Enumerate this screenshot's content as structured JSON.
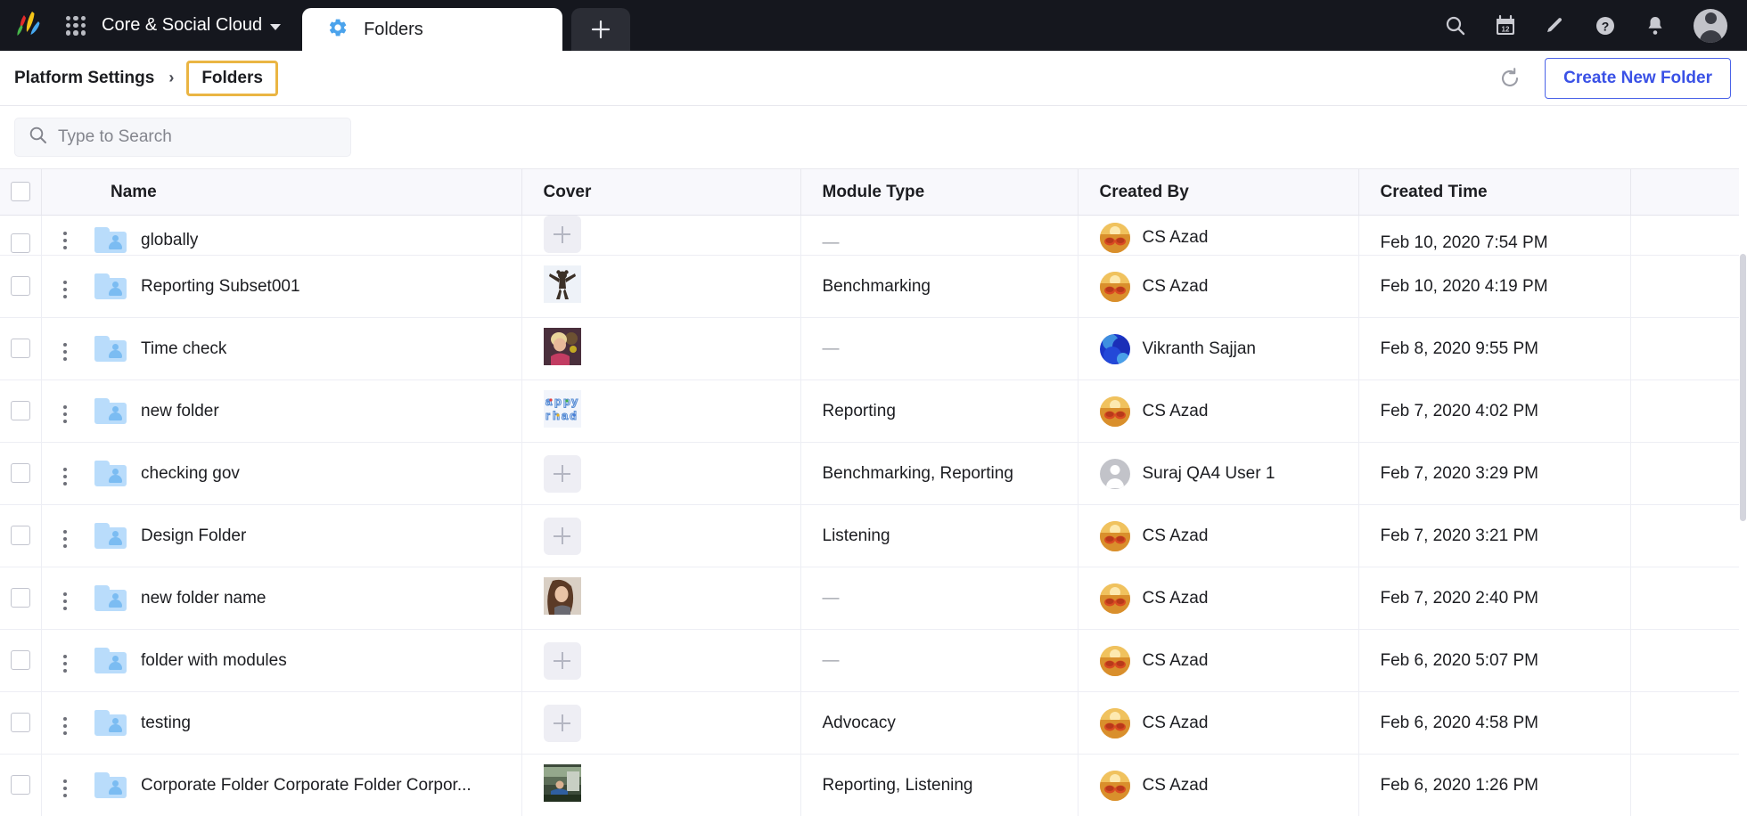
{
  "topbar": {
    "logo": "sprinklr-logo",
    "app_grid_label": "app-grid",
    "workspace": "Core & Social Cloud",
    "tabs": [
      {
        "label": "Folders",
        "icon": "gear-icon",
        "active": true
      }
    ],
    "new_tab_label": "+",
    "icons": [
      {
        "name": "search-icon"
      },
      {
        "name": "calendar-icon",
        "badge": "12"
      },
      {
        "name": "edit-pencil-icon"
      },
      {
        "name": "help-icon"
      },
      {
        "name": "notifications-bell-icon"
      }
    ],
    "avatar": "user-avatar"
  },
  "breadcrumb": {
    "parent": "Platform Settings",
    "separator": "›",
    "current": "Folders",
    "refresh_label": "refresh-icon",
    "create_button": "Create New Folder"
  },
  "search": {
    "placeholder": "Type to Search",
    "value": "",
    "icon": "search-icon"
  },
  "table": {
    "columns": [
      "Name",
      "Cover",
      "Module Type",
      "Created By",
      "Created Time"
    ],
    "rows": [
      {
        "name": "globally",
        "cover": "placeholder",
        "module_type": "—",
        "created_by": "CS Azad",
        "avatar": "sunset",
        "created_time": "Feb 10, 2020 7:54 PM",
        "clipped": true
      },
      {
        "name": "Reporting Subset001",
        "cover": "photo-bear",
        "module_type": "Benchmarking",
        "created_by": "CS Azad",
        "avatar": "sunset",
        "created_time": "Feb 10, 2020 4:19 PM"
      },
      {
        "name": "Time check",
        "cover": "photo-woman-blonde",
        "module_type": "—",
        "created_by": "Vikranth Sajjan",
        "avatar": "blue",
        "created_time": "Feb 8, 2020 9:55 PM"
      },
      {
        "name": "new folder",
        "cover": "photo-letters",
        "module_type": "Reporting",
        "created_by": "CS Azad",
        "avatar": "sunset",
        "created_time": "Feb 7, 2020 4:02 PM"
      },
      {
        "name": "checking gov",
        "cover": "placeholder",
        "module_type": "Benchmarking, Reporting",
        "created_by": "Suraj QA4 User 1",
        "avatar": "gray",
        "created_time": "Feb 7, 2020 3:29 PM"
      },
      {
        "name": "Design Folder",
        "cover": "placeholder",
        "module_type": "Listening",
        "created_by": "CS Azad",
        "avatar": "sunset",
        "created_time": "Feb 7, 2020 3:21 PM"
      },
      {
        "name": "new folder name",
        "cover": "photo-woman-brunette",
        "module_type": "—",
        "created_by": "CS Azad",
        "avatar": "sunset",
        "created_time": "Feb 7, 2020 2:40 PM"
      },
      {
        "name": "folder with modules",
        "cover": "placeholder",
        "module_type": "—",
        "created_by": "CS Azad",
        "avatar": "sunset",
        "created_time": "Feb 6, 2020 5:07 PM"
      },
      {
        "name": "testing",
        "cover": "placeholder",
        "module_type": "Advocacy",
        "created_by": "CS Azad",
        "avatar": "sunset",
        "created_time": "Feb 6, 2020 4:58 PM"
      },
      {
        "name": "Corporate Folder Corporate Folder Corpor...",
        "cover": "photo-workshop",
        "module_type": "Reporting, Listening",
        "created_by": "CS Azad",
        "avatar": "sunset",
        "created_time": "Feb 6, 2020 1:26 PM"
      }
    ]
  },
  "colors": {
    "topbar_bg": "#15171e",
    "accent_blue": "#3a51e6",
    "focus_outline": "#eab543",
    "folder_blue": "#b9dcfb",
    "header_bg": "#f8f8fc"
  }
}
